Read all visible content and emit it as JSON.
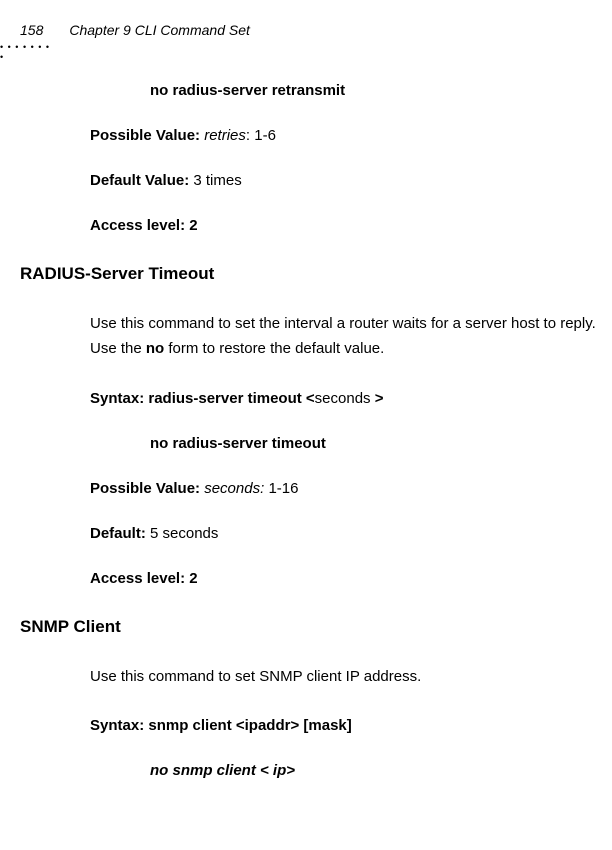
{
  "header": {
    "page_number": "158",
    "chapter_title": "Chapter 9 CLI Command Set"
  },
  "retransmit": {
    "command_title": "no radius-server retransmit",
    "possible_value_label": "Possible Value: ",
    "possible_value_param": "retries",
    "possible_value_range": ": 1-6",
    "default_value_label": "Default Value: ",
    "default_value_text": "3 times",
    "access_level_label": "Access level: 2"
  },
  "timeout": {
    "heading": "RADIUS-Server Timeout",
    "description_part1": "Use this command to set the interval a router waits for a server host to reply. Use the ",
    "description_bold": "no",
    "description_part2": " form to restore the default value.",
    "syntax_label": "Syntax: radius-server timeout <",
    "syntax_param": "seconds ",
    "syntax_close": ">",
    "no_form": "no  radius-server timeout",
    "possible_value_label": "Possible Value:  ",
    "possible_value_param": "seconds:  ",
    "possible_value_range": "1-16",
    "default_label": "Default: ",
    "default_text": "5 seconds",
    "access_level_label": "Access level: 2"
  },
  "snmp": {
    "heading": "SNMP Client",
    "description": "Use this command to set SNMP client IP address.",
    "syntax_label": "Syntax: snmp client <ipaddr> [mask]",
    "no_form": "no snmp client < ip>"
  }
}
